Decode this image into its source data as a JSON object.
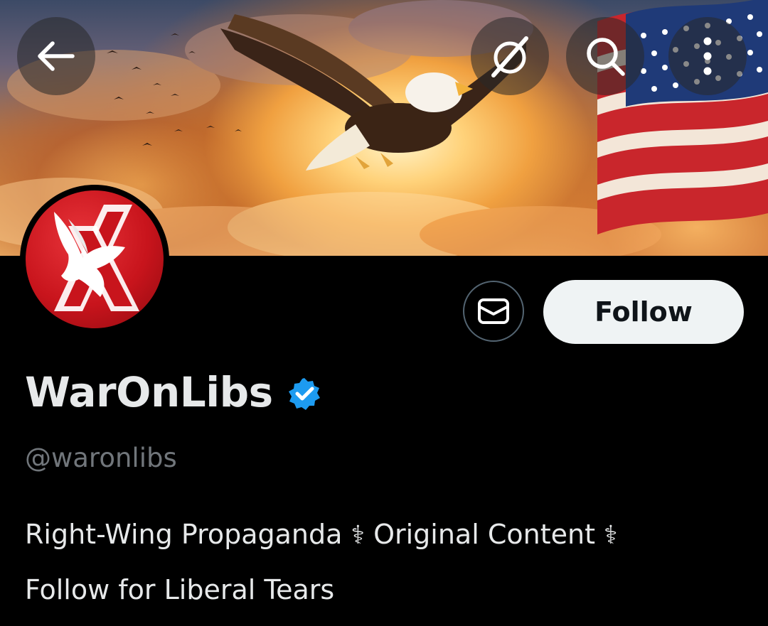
{
  "header": {
    "back_icon": "arrow-left-icon",
    "grok_icon": "grok-icon",
    "search_icon": "search-icon",
    "more_icon": "more-vertical-icon"
  },
  "banner": {
    "description_icon": "eagle-flag-banner"
  },
  "profile": {
    "display_name": "WarOnLibs",
    "handle": "@waronlibs",
    "verified_icon": "verified-badge-icon",
    "verified_color": "#1d9bf0"
  },
  "actions": {
    "message_icon": "mail-icon",
    "follow_label": "Follow"
  },
  "bio": {
    "line1_part1": "Right-Wing Propaganda ",
    "separator1": "⚕",
    "line1_part2": " Original Content ",
    "separator2": "⚕",
    "line2": "Follow for Liberal Tears"
  },
  "colors": {
    "background": "#000000",
    "text_primary": "#e7e9ea",
    "text_secondary": "#71767b",
    "follow_bg": "#eff3f4",
    "avatar_red": "#c8141c"
  }
}
